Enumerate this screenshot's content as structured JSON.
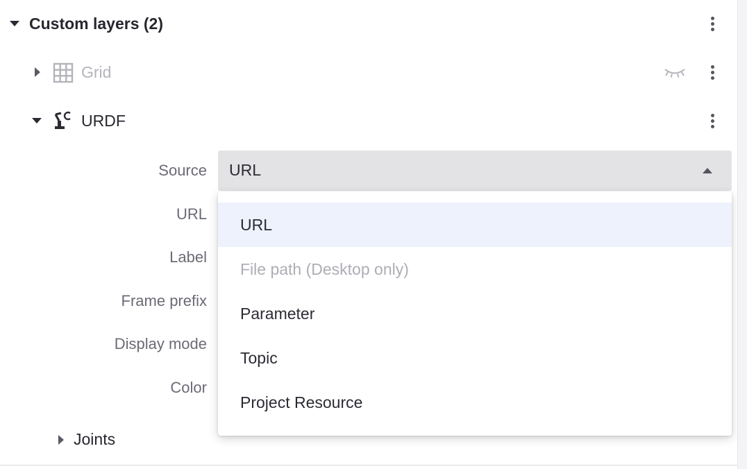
{
  "section": {
    "title": "Custom layers (2)",
    "expanded": true
  },
  "layers": [
    {
      "label": "Grid",
      "icon": "grid-icon",
      "expanded": false,
      "visible": false
    },
    {
      "label": "URDF",
      "icon": "robot-arm-icon",
      "expanded": true,
      "visible": true
    }
  ],
  "urdf_fields": {
    "source_label": "Source",
    "url_label": "URL",
    "label_label": "Label",
    "frame_prefix_label": "Frame prefix",
    "display_mode_label": "Display mode",
    "color_label": "Color"
  },
  "source_select": {
    "value": "URL",
    "open": true,
    "options": [
      {
        "label": "URL",
        "selected": true,
        "disabled": false
      },
      {
        "label": "File path (Desktop only)",
        "selected": false,
        "disabled": true
      },
      {
        "label": "Parameter",
        "selected": false,
        "disabled": false
      },
      {
        "label": "Topic",
        "selected": false,
        "disabled": false
      },
      {
        "label": "Project Resource",
        "selected": false,
        "disabled": false
      }
    ]
  },
  "joints": {
    "label": "Joints",
    "expanded": false
  },
  "colors": {
    "selected_option_bg": "#eef2fd",
    "select_bg": "#e3e3e6",
    "muted_text": "#b3b3ba",
    "label_text": "#6b6b75"
  }
}
